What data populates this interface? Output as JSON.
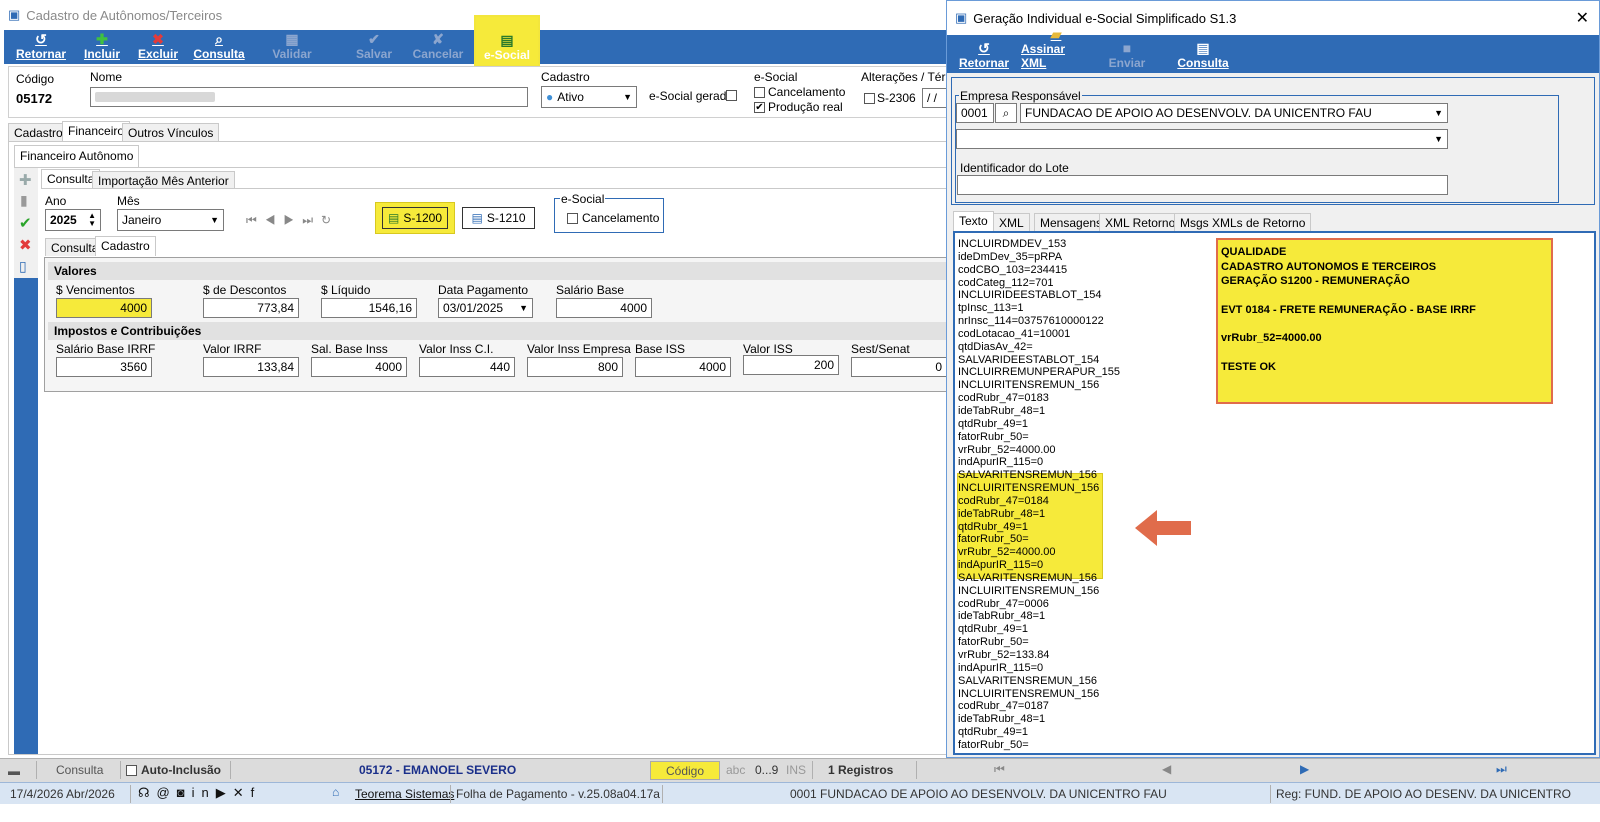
{
  "main": {
    "title": "Cadastro de Autônomos/Terceiros",
    "toolbar": {
      "retornar": "Retornar",
      "incluir": "Incluir",
      "excluir": "Excluir",
      "consulta": "Consulta",
      "validar": "Validar",
      "salvar": "Salvar",
      "cancelar": "Cancelar",
      "esocial": "e-Social"
    },
    "header": {
      "codigo_label": "Código",
      "codigo_value": "05172",
      "nome_label": "Nome",
      "nome_value": "",
      "cadastro_label": "Cadastro",
      "cadastro_value": "Ativo",
      "esocial_gerado_label": "e-Social gerado",
      "esocial_label": "e-Social",
      "cancelamento_label": "Cancelamento",
      "producao_label": "Produção real",
      "alteracoes_label": "Alterações / Térm",
      "s2306_label": "S-2306",
      "date_value": " / /"
    },
    "tabs": [
      "Cadastro",
      "Financeiro",
      "Outros Vínculos"
    ],
    "subtab": "Financeiro Autônomo",
    "inner_tabs": [
      "Consulta",
      "Importação Mês Anterior"
    ],
    "ano_label": "Ano",
    "ano_value": "2025",
    "mes_label": "Mês",
    "mes_value": "Janeiro",
    "s1200_label": "S-1200",
    "s1210_label": "S-1210",
    "esocial_group_label": "e-Social",
    "cancelamento2_label": "Cancelamento",
    "sub_tabs": [
      "Consulta",
      "Cadastro"
    ],
    "valores": {
      "title": "Valores",
      "vencimentos_label": "$ Vencimentos",
      "vencimentos_value": "4000",
      "descontos_label": "$ de Descontos",
      "descontos_value": "773,84",
      "liquido_label": "$ Líquido",
      "liquido_value": "1546,16",
      "data_pag_label": "Data Pagamento",
      "data_pag_value": "03/01/2025",
      "salario_base_label": "Salário Base",
      "salario_base_value": "4000"
    },
    "impostos": {
      "title": "Impostos e Contribuições",
      "sal_irrf_label": "Salário Base IRRF",
      "sal_irrf_value": "3560",
      "valor_irrf_label": "Valor IRRF",
      "valor_irrf_value": "133,84",
      "sal_inss_label": "Sal. Base Inss",
      "sal_inss_value": "4000",
      "inss_ci_label": "Valor Inss C.I.",
      "inss_ci_value": "440",
      "inss_emp_label": "Valor Inss Empresa",
      "inss_emp_value": "800",
      "base_iss_label": "Base ISS",
      "base_iss_value": "4000",
      "valor_iss_label": "Valor ISS",
      "valor_iss_value": "200",
      "sest_label": "Sest/Senat",
      "sest_value": "0"
    }
  },
  "dialog": {
    "title": "Geração Individual e-Social Simplificado S1.3",
    "toolbar": {
      "retornar": "Retornar",
      "assinar": "Assinar XML",
      "enviar": "Enviar",
      "consulta": "Consulta"
    },
    "empresa_label": "Empresa Responsável",
    "empresa_code": "0001",
    "empresa_name": "FUNDACAO DE APOIO AO DESENVOLV. DA UNICENTRO FAU",
    "lote_label": "Identificador do Lote",
    "tabs": [
      "Texto",
      "XML",
      "Mensagens",
      "XML Retorno",
      "Msgs XMLs de Retorno"
    ],
    "xml_lines": [
      "INCLUIRDMDEV_153",
      "ideDmDev_35=pRPA",
      "codCBO_103=234415",
      "codCateg_112=701",
      "INCLUIRIDEESTABLOT_154",
      "tpInsc_113=1",
      "nrInsc_114=03757610000122",
      "codLotacao_41=10001",
      "qtdDiasAv_42=",
      "SALVARIDEESTABLOT_154",
      "INCLUIRREMUNPERAPUR_155",
      "INCLUIRITENSREMUN_156",
      "codRubr_47=0183",
      "ideTabRubr_48=1",
      "qtdRubr_49=1",
      "fatorRubr_50=",
      "vrRubr_52=4000.00",
      "indApurIR_115=0",
      "SALVARITENSREMUN_156",
      "INCLUIRITENSREMUN_156",
      "codRubr_47=0184",
      "ideTabRubr_48=1",
      "qtdRubr_49=1",
      "fatorRubr_50=",
      "vrRubr_52=4000.00",
      "indApurIR_115=0",
      "SALVARITENSREMUN_156",
      "INCLUIRITENSREMUN_156",
      "codRubr_47=0006",
      "ideTabRubr_48=1",
      "qtdRubr_49=1",
      "fatorRubr_50=",
      "vrRubr_52=133.84",
      "indApurIR_115=0",
      "SALVARITENSREMUN_156",
      "INCLUIRITENSREMUN_156",
      "codRubr_47=0187",
      "ideTabRubr_48=1",
      "qtdRubr_49=1",
      "fatorRubr_50="
    ],
    "note": {
      "line1": "QUALIDADE",
      "line2": "CADASTRO AUTONOMOS E TERCEIROS",
      "line3": "GERAÇÃO S1200 - REMUNERAÇÃO",
      "line4": "EVT 0184 - FRETE REMUNERAÇÃO - BASE IRRF",
      "line5": "vrRubr_52=4000.00",
      "line6": "TESTE OK"
    }
  },
  "status": {
    "consulta": "Consulta",
    "auto_inclusao": "Auto-Inclusão",
    "employee": "05172 - EMANOEL SEVERO",
    "codigo": "Código",
    "abc": "abc",
    "num": "0...9",
    "ins": "INS",
    "registros": "1 Registros"
  },
  "footer": {
    "date": "17/4/2026 Abr/2026",
    "teorema": "Teorema Sistemas",
    "version": "Folha de Pagamento - v.25.08a04.17a",
    "company": "0001 FUNDACAO DE APOIO AO DESENVOLV. DA UNICENTRO FAU",
    "reg": "Reg: FUND. DE APOIO AO DESENV. DA UNICENTRO"
  },
  "colors": {
    "toolbar_blue": "#2f6bb5",
    "highlight_yellow": "#f6ea3a",
    "note_border": "#e06c4b",
    "arrow": "#e06c4b"
  }
}
